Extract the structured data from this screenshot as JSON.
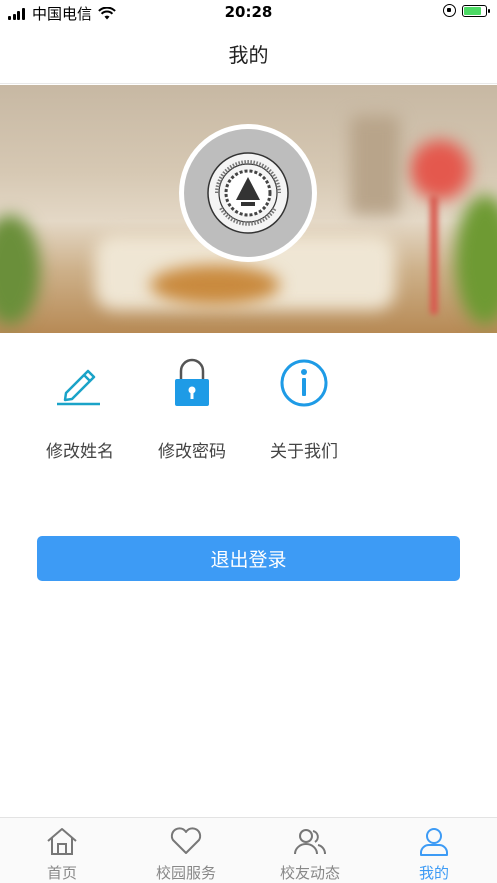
{
  "status_bar": {
    "carrier": "中国电信",
    "time": "20:28",
    "battery_level": 0.8
  },
  "nav": {
    "title": "我的"
  },
  "menu": [
    {
      "label": "修改姓名",
      "icon": "pencil-icon"
    },
    {
      "label": "修改密码",
      "icon": "padlock-icon"
    },
    {
      "label": "关于我们",
      "icon": "info-icon"
    }
  ],
  "logout": {
    "label": "退出登录"
  },
  "tabbar": {
    "items": [
      {
        "label": "首页",
        "icon": "home-icon",
        "active": false
      },
      {
        "label": "校园服务",
        "icon": "heart-icon",
        "active": false
      },
      {
        "label": "校友动态",
        "icon": "users-icon",
        "active": false
      },
      {
        "label": "我的",
        "icon": "user-icon",
        "active": true
      }
    ]
  },
  "colors": {
    "accent": "#3d9bf5",
    "icon_cyan": "#1aa3c8",
    "inactive": "#888888"
  }
}
